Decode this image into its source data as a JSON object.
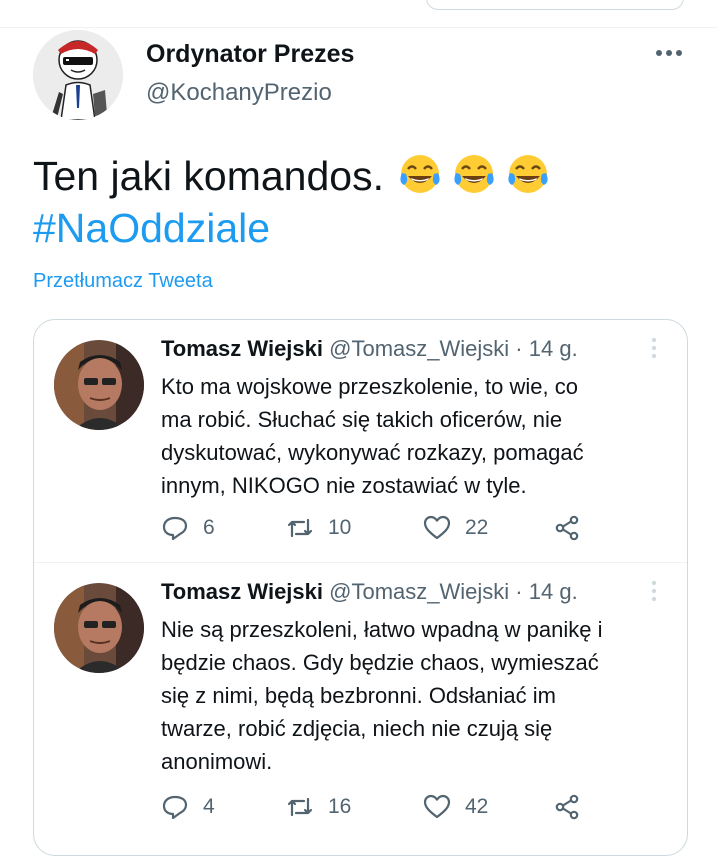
{
  "tweet": {
    "author_name": "Ordynator Prezes",
    "author_handle": "@KochanyPrezio",
    "text_line1": "Ten jaki komandos.",
    "hashtag": "#NaOddziale",
    "translate_label": "Przetłumacz Tweeta",
    "emoji_name": "face-with-tears-of-joy-emoji"
  },
  "quoted_replies": [
    {
      "name": "Tomasz Wiejski",
      "handle": "@Tomasz_Wiejski",
      "separator": "·",
      "time": "14 g.",
      "lines": [
        "Kto ma wojskowe przeszkolenie, to wie, co",
        "ma robić. Słuchać się takich oficerów, nie",
        "dyskutować, wykonywać rozkazy, pomagać",
        "innym, NIKOGO nie zostawiać w tyle."
      ],
      "replies": "6",
      "retweets": "10",
      "likes": "22"
    },
    {
      "name": "Tomasz Wiejski",
      "handle": "@Tomasz_Wiejski",
      "separator": "·",
      "time": "14 g.",
      "lines": [
        "Nie są przeszkoleni, łatwo wpadną w panikę i",
        "będzie chaos. Gdy będzie chaos, wymieszać",
        "się z nimi, będą bezbronni. Odsłaniać im",
        "twarze, robić zdjęcia, niech nie czują się",
        "anonimowi."
      ],
      "replies": "4",
      "retweets": "16",
      "likes": "42"
    }
  ],
  "colors": {
    "link": "#1d9bf0",
    "secondary_text": "#536471",
    "border": "#cfd9de"
  }
}
